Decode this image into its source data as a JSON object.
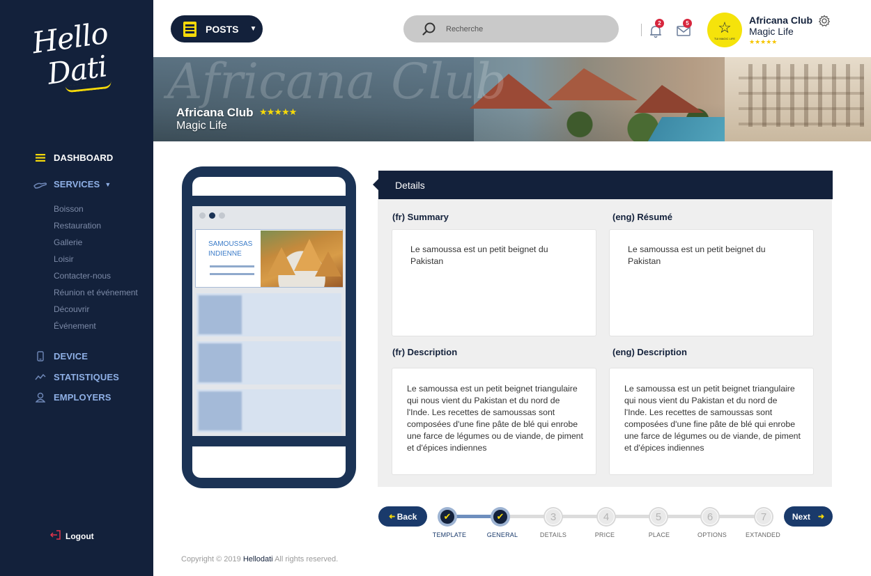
{
  "app": {
    "logo_line1": "Hello",
    "logo_line2": "Dati"
  },
  "sidebar": {
    "dashboard": "DASHBOARD",
    "services": "SERVICES",
    "sub_items": [
      "Boisson",
      "Restauration",
      "Gallerie",
      "Loisir",
      "Contacter-nous",
      "Réunion et événement",
      "Découvrir",
      "Événement"
    ],
    "device": "DEVICE",
    "statistiques": "STATISTIQUES",
    "employers": "EMPLOYERS",
    "logout": "Logout"
  },
  "topbar": {
    "posts_label": "POSTS",
    "search_placeholder": "Recherche",
    "notifications_count": "2",
    "messages_count": "5",
    "hotel_logo_text": "TUI MAGIC LIFE",
    "hotel_name": "Africana Club",
    "hotel_sub": "Magic Life",
    "hotel_stars": "★★★★★"
  },
  "banner": {
    "watermark": "Africana Club",
    "name": "Africana Club",
    "stars": "★★★★★",
    "sub": "Magic Life"
  },
  "preview": {
    "card_title": "SAMOUSSAS INDIENNE"
  },
  "details": {
    "header": "Details",
    "summary_fr_label": "(fr) Summary",
    "summary_en_label": "(eng) Résumé",
    "summary_fr": "Le samoussa est un petit beignet du Pakistan",
    "summary_en": "Le samoussa est un petit beignet du Pakistan",
    "desc_fr_label": "(fr) Description",
    "desc_en_label": "(eng) Description",
    "desc_fr": "Le samoussa est un petit beignet triangulaire qui nous vient du Pakistan et du nord de l'Inde. Les recettes de samoussas sont composées d'une fine pâte de blé qui enrobe une farce de légumes ou de viande, de piment et d'épices indiennes",
    "desc_en": "Le samoussa est un petit beignet triangulaire qui nous vient du Pakistan et du nord de l'Inde. Les recettes de samoussas sont composées d'une fine pâte de blé qui enrobe une farce de légumes ou de viande, de piment et d'épices indiennes"
  },
  "stepper": {
    "back": "Back",
    "next": "Next",
    "steps": [
      {
        "num": "",
        "label": "TEMPLATE",
        "done": true
      },
      {
        "num": "",
        "label": "GENERAL",
        "done": true
      },
      {
        "num": "3",
        "label": "DETAILS",
        "done": false
      },
      {
        "num": "4",
        "label": "PRICE",
        "done": false
      },
      {
        "num": "5",
        "label": "PLACE",
        "done": false
      },
      {
        "num": "6",
        "label": "OPTIONS",
        "done": false
      },
      {
        "num": "7",
        "label": "EXTANDED",
        "done": false
      }
    ]
  },
  "footer": {
    "prefix": "Copyright © 2019",
    "brand": "Hellodati",
    "suffix": "All rights reserved."
  },
  "colors": {
    "navy": "#13213b",
    "accent": "#f5d90a",
    "badge": "#d7263d"
  }
}
